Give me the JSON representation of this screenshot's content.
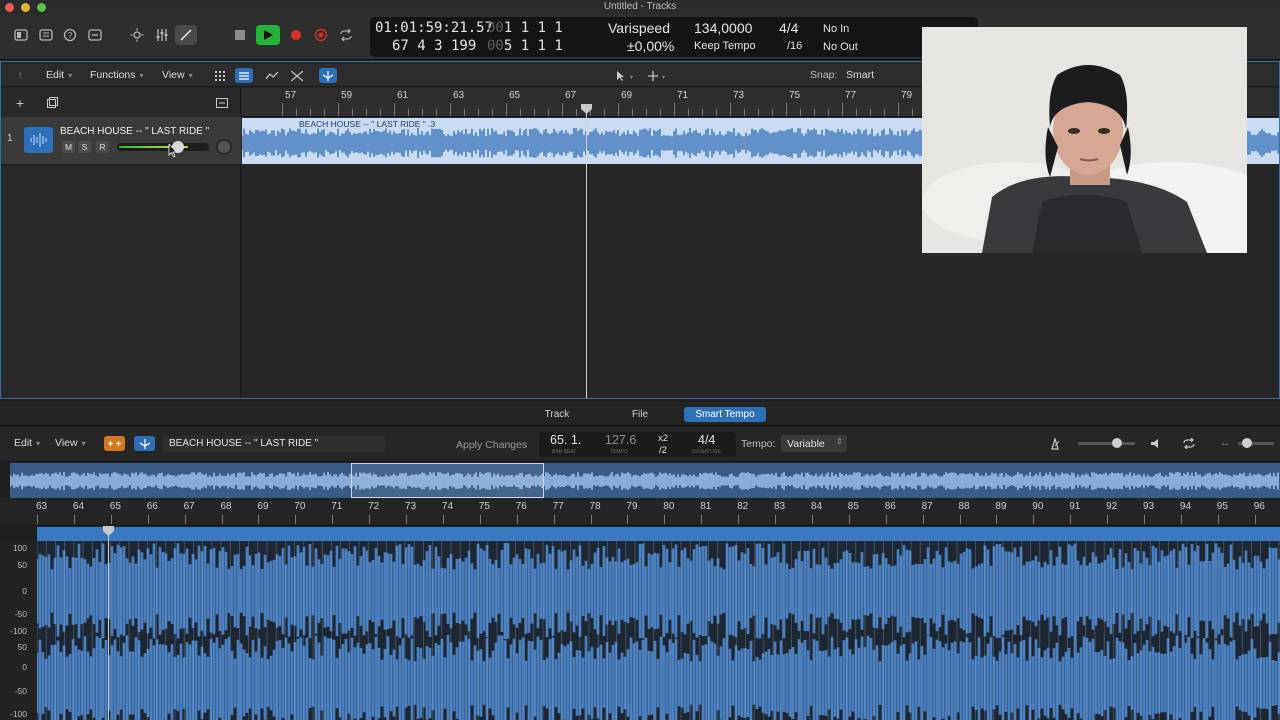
{
  "window": {
    "title": "Untitled - Tracks"
  },
  "lcd": {
    "time": "01:01:59:21.57",
    "time_pos": "67  4  3  199",
    "dim_top": "0001  1  1  1  001",
    "dim_bottom": "0001  5  1  1  001",
    "top_bar_beats": "1  1  1  1",
    "bottom_bar_beats": "5  1  1  1",
    "varispeed_label": "Varispeed",
    "varispeed_value": "±0,00%",
    "tempo": "134,0000",
    "tempo_mode": "Keep Tempo",
    "signature": "4/4",
    "division": "/16",
    "midi_in": "No In",
    "midi_out": "No Out"
  },
  "tracks_toolbar": {
    "edit": "Edit",
    "functions": "Functions",
    "view": "View",
    "snap_label": "Snap:",
    "snap_value": "Smart"
  },
  "track": {
    "number": "1",
    "name": "BEACH HOUSE --  \" LAST RIDE \"",
    "mute": "M",
    "solo": "S",
    "record": "R",
    "volume_level": 0.78
  },
  "region": {
    "label": "BEACH HOUSE --  \" LAST RIDE \" .3"
  },
  "ruler_top": [
    "57",
    "59",
    "61",
    "63",
    "65",
    "67",
    "69",
    "71",
    "73",
    "75",
    "77",
    "79"
  ],
  "editor_tabs": [
    "Track",
    "File",
    "Smart Tempo"
  ],
  "editor_active_tab": "Smart Tempo",
  "editor_toolbar": {
    "edit": "Edit",
    "view": "View",
    "region_name": "BEACH HOUSE --  \" LAST RIDE \"",
    "apply_changes": "Apply Changes",
    "bar_beat": "65. 1.",
    "bar_beat_caption": "BAR   BEAT",
    "tempo_value": "127.6",
    "tempo_caption": "TEMPO",
    "x2": "x2",
    "div2": "/2",
    "signature": "4/4",
    "signature_caption": "SIGNATURE",
    "tempo_label": "Tempo:",
    "tempo_mode": "Variable"
  },
  "ruler_bottom": [
    "63",
    "64",
    "65",
    "66",
    "67",
    "68",
    "69",
    "70",
    "71",
    "72",
    "73",
    "74",
    "75",
    "76",
    "77",
    "78",
    "79",
    "80",
    "81",
    "82",
    "83",
    "84",
    "85",
    "86",
    "87",
    "88",
    "89",
    "90",
    "91",
    "92",
    "93",
    "94",
    "95",
    "96"
  ],
  "db_scale": [
    "100",
    "50",
    "0",
    "-50",
    "-100",
    "50",
    "0",
    "-50",
    "-100"
  ],
  "colors": {
    "accent": "#2f6fb8",
    "region": "#c9dcf3",
    "waveform": "#4a7fc0",
    "play": "#27b33a",
    "record": "#d9302c"
  }
}
